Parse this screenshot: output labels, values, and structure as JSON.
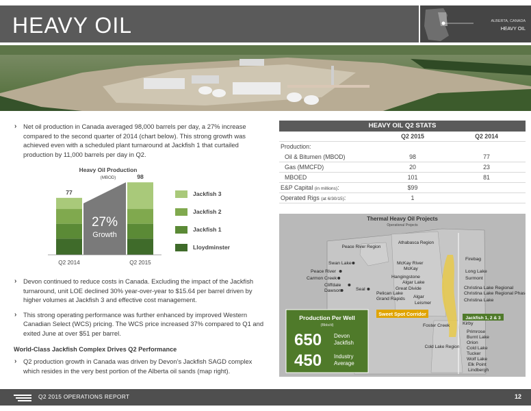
{
  "header": {
    "title": "HEAVY OIL"
  },
  "map_thumb": {
    "line1": "ALBERTA, CANADA",
    "line2": "HEAVY OIL"
  },
  "intro": {
    "bullet1": "Net oil production in Canada averaged 98,000 barrels per day, a 27% increase compared to the second quarter of 2014 (chart below). This strong growth was achieved even with a scheduled plant turnaround at Jackfish 1 that curtailed production by 11,000 barrels per day in Q2."
  },
  "chart_data": {
    "type": "bar",
    "title": "Heavy Oil Production",
    "subtitle": "(MBOD)",
    "categories": [
      "Q2 2014",
      "Q2 2015"
    ],
    "totals": [
      77,
      98
    ],
    "series": [
      {
        "name": "Lloydminster",
        "values": [
          22,
          22
        ],
        "color": "#3f6b2a"
      },
      {
        "name": "Jackfish 1",
        "values": [
          20,
          20
        ],
        "color": "#5b8a36"
      },
      {
        "name": "Jackfish 2",
        "values": [
          20,
          20
        ],
        "color": "#80a94e"
      },
      {
        "name": "Jackfish 3",
        "values": [
          15,
          36
        ],
        "color": "#a9c97a"
      }
    ],
    "growth_label": "27%",
    "growth_sub": "Growth",
    "ylim": [
      0,
      100
    ]
  },
  "lower": {
    "bullet2": "Devon continued to reduce costs in Canada. Excluding the impact of the Jackfish turnaround, unit LOE declined 30% year-over-year to $15.64 per barrel driven by higher volumes at Jackfish 3 and effective cost management.",
    "bullet3": "This strong operating performance was further enhanced by improved Western Canadian Select (WCS) pricing. The WCS price increased 37% compared to Q1 and exited June at over $51 per barrel.",
    "section": "World-Class Jackfish Complex Drives Q2 Performance",
    "bullet4": "Q2 production growth in Canada was driven by Devon’s Jackfish SAGD complex which resides in the very best portion of the Alberta oil sands (map right)."
  },
  "stats": {
    "title": "HEAVY OIL Q2 STATS",
    "col1": "Q2 2015",
    "col2": "Q2 2014",
    "production_label": "Production:",
    "rows": [
      {
        "label": "Oil & Bitumen (MBOD)",
        "v1": "98",
        "v2": "77"
      },
      {
        "label": "Gas (MMCFD)",
        "v1": "20",
        "v2": "23"
      },
      {
        "label": "MBOED",
        "v1": "101",
        "v2": "81"
      }
    ],
    "capital_label": "E&P Capital",
    "capital_note": "(in millions)",
    "capital_value": "$99",
    "rigs_label": "Operated Rigs",
    "rigs_note": "(at 6/30/15)",
    "rigs_value": "1"
  },
  "map": {
    "title": "Thermal Heavy Oil Projects",
    "subtitle": "Operational Projects",
    "regions": [
      "Peace River Region",
      "Athabasca Region",
      "Cold Lake Region"
    ],
    "projects_left": [
      "Swan Lake",
      "Peace River",
      "Carmon Creek",
      "Cliffdale",
      "Dawson",
      "Seal"
    ],
    "projects_mid": [
      "McKay River",
      "McKay",
      "Hangingstone",
      "Algar Lake",
      "Great Divide",
      "Pelican Lake",
      "Grand Rapids",
      "Algar",
      "Leismer",
      "Foster Creek"
    ],
    "projects_right": [
      "Firebag",
      "Long Lake",
      "Surmont",
      "Christina Lake Regional",
      "Christina Lake Regional Phase 3",
      "Christina Lake",
      "Jackfish 1, 2 & 3",
      "Kirby",
      "Primrose",
      "Burnt Lake",
      "Orion",
      "Cold Lake",
      "Tucker",
      "Wolf Lake",
      "Elk Point",
      "Lindbergh"
    ],
    "corridor_label": "Sweet Spot Corridor",
    "ppw_title": "Production Per Well",
    "ppw_unit": "(Bbls/d)",
    "ppw1_value": "650",
    "ppw1_label_a": "Devon",
    "ppw1_label_b": "Jackfish",
    "ppw2_value": "450",
    "ppw2_label_a": "Industry",
    "ppw2_label_b": "Average"
  },
  "footer": {
    "report": "Q2 2015  OPERATIONS REPORT",
    "page": "12"
  }
}
